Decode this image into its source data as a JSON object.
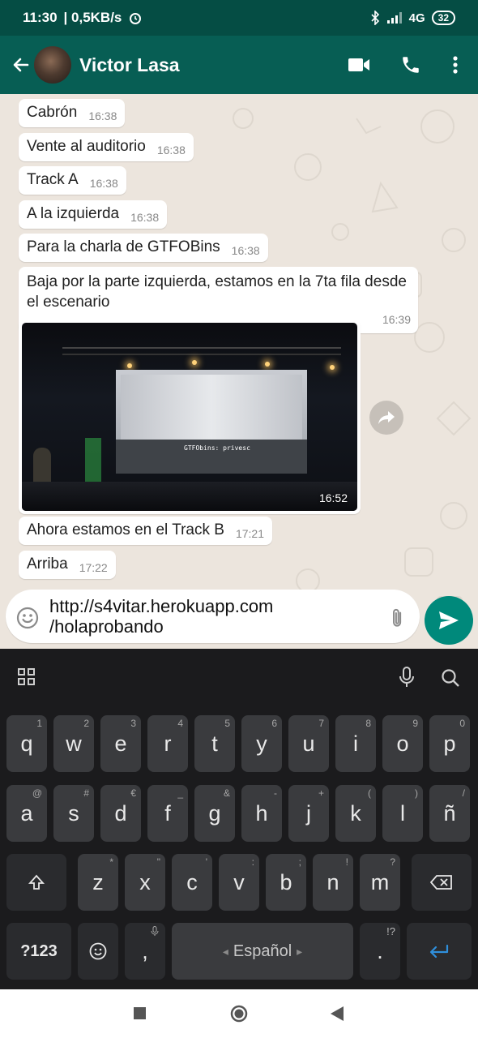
{
  "status_bar": {
    "time": "11:30",
    "speed": "| 0,5KB/s",
    "network": "4G",
    "battery": "32"
  },
  "header": {
    "contact_name": "Victor Lasa"
  },
  "messages": [
    {
      "text": "Cabrón",
      "time": "16:38"
    },
    {
      "text": "Vente al auditorio",
      "time": "16:38"
    },
    {
      "text": "Track A",
      "time": "16:38"
    },
    {
      "text": "A la izquierda",
      "time": "16:38"
    },
    {
      "text": "Para la charla de GTFOBins",
      "time": "16:38"
    },
    {
      "text": "Baja por la parte izquierda, estamos en la 7ta fila desde el escenario",
      "time": "16:39"
    },
    {
      "text": "Ahora estamos en el Track B",
      "time": "17:21"
    },
    {
      "text": "Arriba",
      "time": "17:22"
    }
  ],
  "media_message": {
    "time": "16:52",
    "slide_text": "GTFObins: privesc"
  },
  "composer": {
    "value_line1": "http://s4vitar.herokuapp.com",
    "value_line2": "/holaprobando"
  },
  "keyboard": {
    "row1": [
      {
        "k": "q",
        "h": "1"
      },
      {
        "k": "w",
        "h": "2"
      },
      {
        "k": "e",
        "h": "3"
      },
      {
        "k": "r",
        "h": "4"
      },
      {
        "k": "t",
        "h": "5"
      },
      {
        "k": "y",
        "h": "6"
      },
      {
        "k": "u",
        "h": "7"
      },
      {
        "k": "i",
        "h": "8"
      },
      {
        "k": "o",
        "h": "9"
      },
      {
        "k": "p",
        "h": "0"
      }
    ],
    "row2": [
      {
        "k": "a",
        "h": "@"
      },
      {
        "k": "s",
        "h": "#"
      },
      {
        "k": "d",
        "h": "€"
      },
      {
        "k": "f",
        "h": "_"
      },
      {
        "k": "g",
        "h": "&"
      },
      {
        "k": "h",
        "h": "-"
      },
      {
        "k": "j",
        "h": "+"
      },
      {
        "k": "k",
        "h": "("
      },
      {
        "k": "l",
        "h": ")"
      },
      {
        "k": "ñ",
        "h": "/"
      }
    ],
    "row3": [
      {
        "k": "z",
        "h": "*"
      },
      {
        "k": "x",
        "h": "\""
      },
      {
        "k": "c",
        "h": "'"
      },
      {
        "k": "v",
        "h": ":"
      },
      {
        "k": "b",
        "h": ";"
      },
      {
        "k": "n",
        "h": "!"
      },
      {
        "k": "m",
        "h": "?"
      }
    ],
    "symbols_label": "?123",
    "comma": ",",
    "space_label": "Español",
    "period": ".",
    "period_hint": "!?"
  },
  "colors": {
    "header": "#075e54",
    "status": "#054d44",
    "send": "#00897b",
    "chat_bg": "#ece5dd",
    "keyboard_bg": "#1b1b1d"
  }
}
